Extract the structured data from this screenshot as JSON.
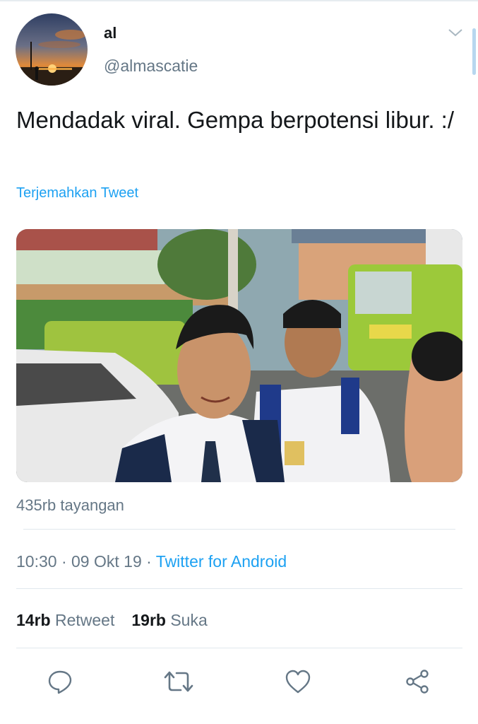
{
  "tweet": {
    "author_name": "al",
    "author_handle": "@almascatie",
    "text": "Mendadak viral. Gempa berpotensi libur. :/",
    "translate_label": "Terjemahkan Tweet",
    "views": "435rb tayangan",
    "time": "10:30",
    "date": "09 Okt 19",
    "separator": "·",
    "source": "Twitter for Android",
    "retweet_count": "14rb",
    "retweet_label": "Retweet",
    "like_count": "19rb",
    "like_label": "Suka"
  },
  "icons": {
    "avatar": "sunset-photo-avatar",
    "menu": "chevron-down-icon",
    "reply": "reply-icon",
    "retweet": "retweet-icon",
    "like": "heart-icon",
    "share": "share-icon"
  },
  "colors": {
    "link": "#1da1f2",
    "secondary_text": "#657786",
    "primary_text": "#14171a",
    "divider": "#e1e8ed"
  }
}
